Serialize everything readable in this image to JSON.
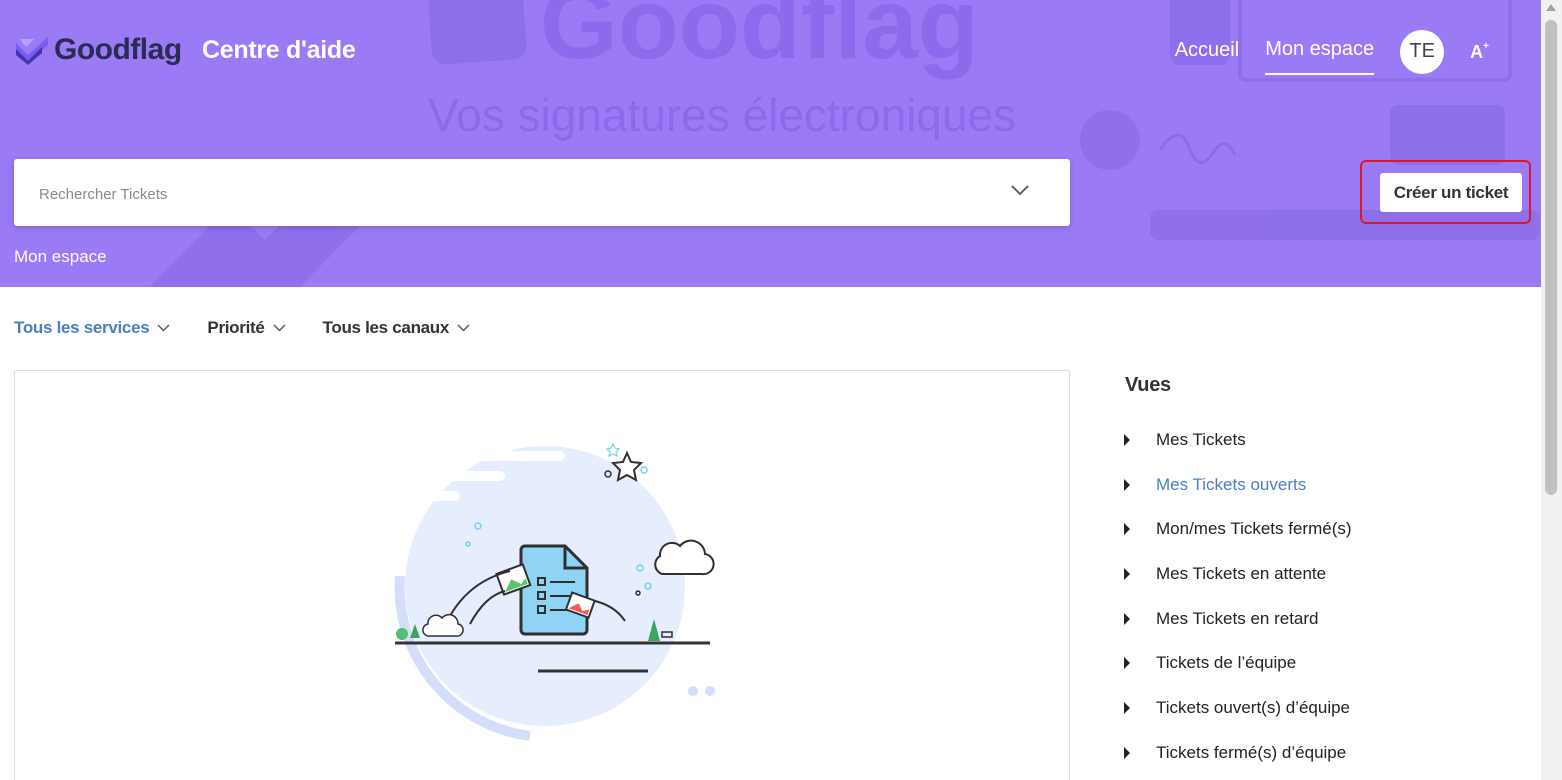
{
  "header": {
    "logo_text": "Goodflag",
    "site_title": "Centre d'aide",
    "background_slogan": "Vos signatures électroniques",
    "nav": {
      "home_label": "Accueil",
      "my_space_label": "Mon espace",
      "avatar_initials": "TE",
      "font_size_label": "A"
    }
  },
  "search": {
    "placeholder": "Rechercher Tickets",
    "value": ""
  },
  "create_ticket_label": "Créer un ticket",
  "breadcrumb": "Mon espace",
  "filters": [
    {
      "label": "Tous les services",
      "active": true
    },
    {
      "label": "Priorité",
      "active": false
    },
    {
      "label": "Tous les canaux",
      "active": false
    }
  ],
  "views": {
    "title": "Vues",
    "items": [
      {
        "label": "Mes Tickets",
        "active": false
      },
      {
        "label": "Mes Tickets ouverts",
        "active": true
      },
      {
        "label": "Mon/mes Tickets fermé(s)",
        "active": false
      },
      {
        "label": "Mes Tickets en attente",
        "active": false
      },
      {
        "label": "Mes Tickets en retard",
        "active": false
      },
      {
        "label": "Tickets de l’équipe",
        "active": false
      },
      {
        "label": "Tickets ouvert(s) d’équipe",
        "active": false
      },
      {
        "label": "Tickets fermé(s) d’équipe",
        "active": false
      }
    ]
  },
  "colors": {
    "header_bg": "#9b7af5",
    "accent_link": "#4a7fc1",
    "highlight_outline": "#e0162b",
    "illustration_blue": "#e6edfc"
  },
  "icons": {
    "search_dropdown": "chevron-down-icon",
    "filter_dropdown": "chevron-down-icon",
    "view_expand": "caret-right-icon",
    "empty_state": "empty-document-illustration"
  }
}
